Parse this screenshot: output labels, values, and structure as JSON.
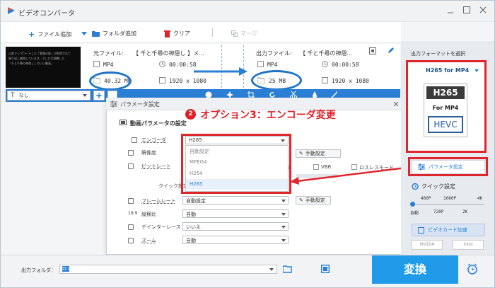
{
  "app": {
    "title": "ビデオコンバータ"
  },
  "toolbar": {
    "add_file": "ファイル追加",
    "add_folder": "フォルダ追加",
    "clear": "クリア",
    "merge": "マージ"
  },
  "source": {
    "label": "元ファイル:",
    "name": "【 千と千尋の神隠し 】メ...",
    "format": "MP4",
    "duration": "00:00:58",
    "size": "40.32 MB",
    "resolution": "1920 x 1080"
  },
  "output": {
    "label": "出力ファイル:",
    "name": "【 千と千尋の神隠...",
    "format": "MP4",
    "duration": "00:00:58",
    "size": "25 MB",
    "resolution": "1920 x 1080"
  },
  "thumbnail": {
    "lines": [
      "以前アップロードした「素晴の扉」が削除されて",
      "繰り返し後悔しています。少しだけ調整した",
      "「千と千尋の神隠し」のいい動画。"
    ]
  },
  "subtitle": {
    "value": "なし"
  },
  "dialog": {
    "title": "パラメータ設定",
    "section": "動画パラメータの設定",
    "annotation_number": "2",
    "annotation": "オプション3：エンコーダ変更",
    "encoder": {
      "label": "エンコーダ",
      "value": "H265",
      "options": [
        "自動設定",
        "MPEG4",
        "H264",
        "H265"
      ]
    },
    "resolution": {
      "label": "解像度"
    },
    "bitrate": {
      "label": "ビットレート"
    },
    "quick": {
      "label": "クイック設定"
    },
    "framerate": {
      "label": "フレームレート",
      "value": "自動設定"
    },
    "aspect": {
      "label": "縦横比",
      "value": "自動"
    },
    "deinterlace": {
      "label": "デインターレース",
      "value": "いいえ"
    },
    "zoom": {
      "label": "ズーム",
      "value": "自動"
    },
    "manual_label": "手動設定",
    "vbr_label": "VBR",
    "lossless_label": "ロスレスモード"
  },
  "right": {
    "select_label": "出力フォーマットを選択",
    "format_name": "H265 for MP4",
    "badge_top": "H265",
    "badge_mid": "For MP4",
    "badge_bottom": "HEVC",
    "params_button": "パラメータ設定",
    "quick_setting": "クイック設定",
    "marks_top": [
      "480P",
      "1080P",
      "4K"
    ],
    "marks_bottom": [
      "自動",
      "720P",
      "2K"
    ],
    "gpu_accel": "ビデオカード加速",
    "nvidia": "NVIDIA",
    "intel": "Intel"
  },
  "bottom": {
    "output_folder_label": "出力フォルダ：",
    "path": "D:\\",
    "convert_label": "変換"
  },
  "colors": {
    "accent": "#2a7fd4",
    "annotation": "#e21f26",
    "convert": "#1f9be9"
  }
}
